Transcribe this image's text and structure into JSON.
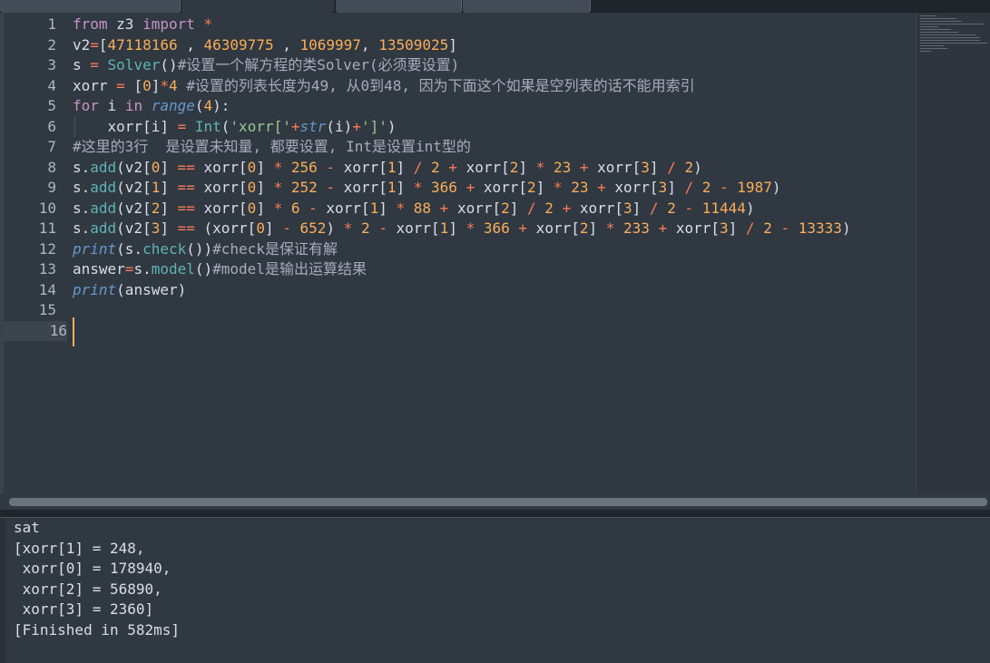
{
  "editor": {
    "line_numbers": [
      "1",
      "2",
      "3",
      "4",
      "5",
      "6",
      "7",
      "8",
      "9",
      "10",
      "11",
      "12",
      "13",
      "14",
      "15",
      "16"
    ],
    "active_line": "16",
    "code": {
      "l1": [
        "from",
        " z3 ",
        "import",
        " ",
        "*"
      ],
      "l2": [
        "v2",
        "=",
        "[",
        "47118166",
        " , ",
        "46309775",
        " , ",
        "1069997",
        ", ",
        "13509025",
        "]"
      ],
      "l3": [
        "s ",
        "=",
        " ",
        "Solver",
        "()",
        "#设置一个解方程的类Solver(必须要设置)"
      ],
      "l4": [
        "xorr ",
        "=",
        " [",
        "0",
        "]",
        "*",
        "4",
        " ",
        "#设置的列表长度为49, 从0到48, 因为下面这个如果是空列表的话不能用索引"
      ],
      "l5": [
        "for",
        " i ",
        "in",
        " ",
        "range",
        "(",
        "4",
        "):"
      ],
      "l6": [
        "    xorr[i] ",
        "=",
        " ",
        "Int",
        "(",
        "'xorr['",
        "+",
        "str",
        "(i)",
        "+",
        "']'",
        ")"
      ],
      "l7": [
        "#这里的3行  是设置未知量, 都要设置, Int是设置int型的"
      ],
      "l8": [
        "s.",
        "add",
        "(v2[",
        "0",
        "] ",
        "==",
        " xorr[",
        "0",
        "] ",
        "*",
        " ",
        "256",
        " ",
        "-",
        " xorr[",
        "1",
        "] ",
        "/",
        " ",
        "2",
        " ",
        "+",
        " xorr[",
        "2",
        "] ",
        "*",
        " ",
        "23",
        " ",
        "+",
        " xorr[",
        "3",
        "] ",
        "/",
        " ",
        "2",
        ")"
      ],
      "l9": [
        "s.",
        "add",
        "(v2[",
        "1",
        "] ",
        "==",
        " xorr[",
        "0",
        "] ",
        "*",
        " ",
        "252",
        " ",
        "-",
        " xorr[",
        "1",
        "] ",
        "*",
        " ",
        "366",
        " ",
        "+",
        " xorr[",
        "2",
        "] ",
        "*",
        " ",
        "23",
        " ",
        "+",
        " xorr[",
        "3",
        "] ",
        "/",
        " ",
        "2",
        " ",
        "-",
        " ",
        "1987",
        ")"
      ],
      "l10": [
        "s.",
        "add",
        "(v2[",
        "2",
        "] ",
        "==",
        " xorr[",
        "0",
        "] ",
        "*",
        " ",
        "6",
        " ",
        "-",
        " xorr[",
        "1",
        "] ",
        "*",
        " ",
        "88",
        " ",
        "+",
        " xorr[",
        "2",
        "] ",
        "/",
        " ",
        "2",
        " ",
        "+",
        " xorr[",
        "3",
        "] ",
        "/",
        " ",
        "2",
        " ",
        "-",
        " ",
        "11444",
        ")"
      ],
      "l11": [
        "s.",
        "add",
        "(v2[",
        "3",
        "] ",
        "==",
        " (xorr[",
        "0",
        "] ",
        "-",
        " ",
        "652",
        ") ",
        "*",
        " ",
        "2",
        " ",
        "-",
        " xorr[",
        "1",
        "] ",
        "*",
        " ",
        "366",
        " ",
        "+",
        " xorr[",
        "2",
        "] ",
        "*",
        " ",
        "233",
        " ",
        "+",
        " xorr[",
        "3",
        "] ",
        "/",
        " ",
        "2",
        " ",
        "-",
        " ",
        "13333",
        ")"
      ],
      "l12": [
        "print",
        "(s.",
        "check",
        "())",
        "#check是保证有解"
      ],
      "l13": [
        "answer",
        "=",
        "s.",
        "model",
        "()",
        "#model是输出运算结果"
      ],
      "l14": [
        "print",
        "(answer)"
      ]
    }
  },
  "output": {
    "lines": [
      "sat",
      "[xorr[1] = 248,",
      " xorr[0] = 178940,",
      " xorr[2] = 56890,",
      " xorr[3] = 2360]",
      "[Finished in 582ms]"
    ]
  },
  "colors": {
    "background": "#303841",
    "keyword": "#c594c5",
    "operator": "#f97b58",
    "number": "#f9ae58",
    "function": "#5fb4b4",
    "builtin": "#6699cc",
    "string": "#99c794",
    "comment": "#a6acb9"
  }
}
